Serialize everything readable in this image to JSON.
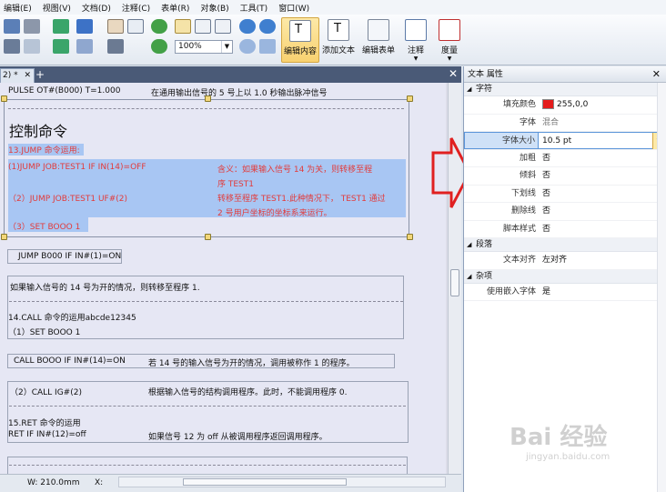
{
  "menu": [
    "编辑(E)",
    "视图(V)",
    "文档(D)",
    "注释(C)",
    "表单(R)",
    "对象(B)",
    "工具(T)",
    "窗口(W)"
  ],
  "toolbar": {
    "zoom": "100%",
    "buttons": [
      {
        "label": "编辑内容",
        "icon": "edit-content-icon"
      },
      {
        "label": "添加文本",
        "icon": "add-text-icon"
      },
      {
        "label": "编辑表单",
        "icon": "edit-form-icon"
      },
      {
        "label": "注释",
        "icon": "comment-icon"
      },
      {
        "label": "度量",
        "icon": "measure-icon"
      }
    ]
  },
  "document_tab": {
    "label": "2) *"
  },
  "document": {
    "lines": [
      {
        "left": "PULSE OT#(B000) T=1.000",
        "right": "在通用输出信号的 5 号上以 1.0 秒输出脉冲信号"
      },
      {
        "heading": "控制命令"
      },
      {
        "left": "13.JUMP 命令运用:"
      },
      {
        "left": "(1)JUMP JOB:TEST1 IF IN(14)=OFF",
        "right": "含义：如果输入信号 14 为关，则转移至程"
      },
      {
        "right": "序 TEST1"
      },
      {
        "left": "（2）JUMP JOB:TEST1 UF#(2)",
        "right": "转移至程序 TEST1.此种情况下， TEST1 通过"
      },
      {
        "right": "2 号用户坐标的坐标系来运行。"
      },
      {
        "left": "（3）SET BOOO 1"
      },
      {
        "left": "JUMP B000 IF IN#(1)=ON"
      },
      {
        "left": "如果输入信号的 14 号为开的情况，则转移至程序 1."
      },
      {
        "left": "14.CALL 命令的运用abcde12345"
      },
      {
        "left": "（1）SET BOOO 1"
      },
      {
        "left": "CALL BOOO IF IN#(14)=ON",
        "right": "若 14 号的输入信号为开的情况，调用被称作 1 的程序。"
      },
      {
        "left": "（2）CALL IG#(2)",
        "right": "根据输入信号的结构调用程序。此时，不能调用程序 0."
      },
      {
        "left": "15.RET 命令的运用"
      },
      {
        "left": "RET IF IN#(12)=off",
        "right": "如果信号 12 为 off 从被调用程序返回调用程序。"
      }
    ]
  },
  "status": {
    "width": "W: 210.0mm",
    "x": "X:"
  },
  "properties": {
    "title": "文本 属性",
    "categories": [
      {
        "name": "字符",
        "rows": [
          {
            "key": "填充颜色",
            "value": "255,0,0",
            "swatch": "#e41c1c"
          },
          {
            "key": "字体",
            "value": "混合"
          },
          {
            "key": "字体大小",
            "value": "10.5 pt",
            "active": true
          },
          {
            "key": "加粗",
            "value": "否"
          },
          {
            "key": "倾斜",
            "value": "否"
          },
          {
            "key": "下划线",
            "value": "否"
          },
          {
            "key": "删除线",
            "value": "否"
          },
          {
            "key": "脚本样式",
            "value": "否"
          }
        ]
      },
      {
        "name": "段落",
        "rows": [
          {
            "key": "文本对齐",
            "value": "左对齐"
          }
        ]
      },
      {
        "name": "杂项",
        "rows": [
          {
            "key": "使用嵌入字体",
            "value": "是"
          }
        ]
      }
    ]
  },
  "watermark": {
    "main": "Bai 经验",
    "sub": "jingyan.baidu.com"
  },
  "colors": {
    "selection": "#a8c6f3",
    "red_text": "#e23b3b",
    "arrow": "#e02020"
  }
}
